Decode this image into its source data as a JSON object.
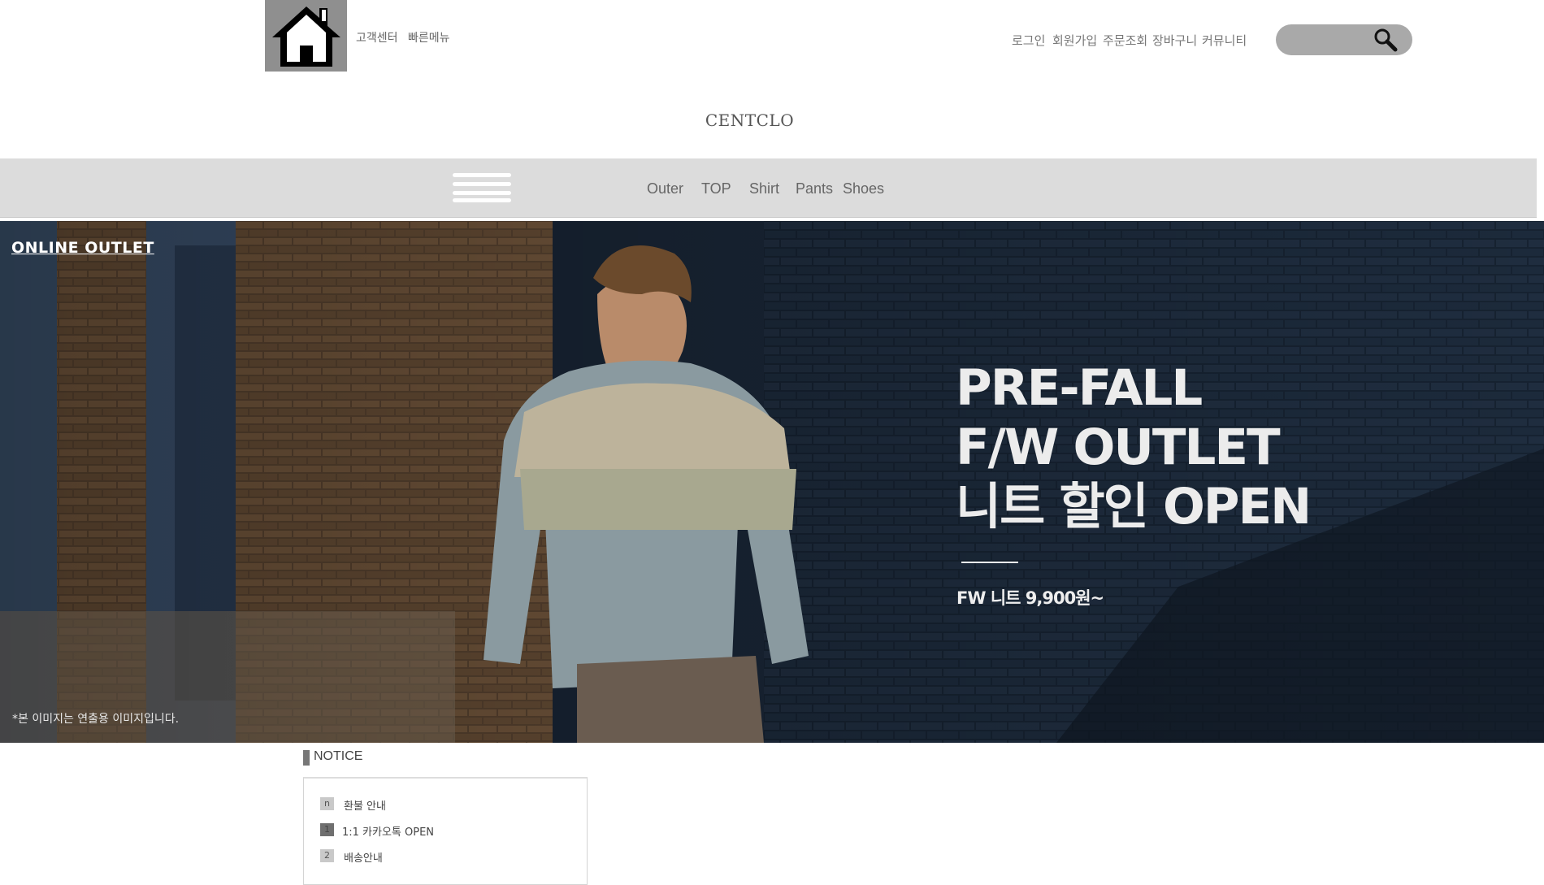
{
  "header": {
    "home_icon": "house-icon",
    "util_links": [
      "고객센터",
      "빠른메뉴"
    ],
    "top_links": [
      "로그인",
      "회원가입",
      "주문조회",
      "장바구니",
      "커뮤니티"
    ],
    "search_icon": "magnifier-icon",
    "brand": "CENTCLO"
  },
  "nav": {
    "menu_icon": "hamburger-icon",
    "items": [
      "Outer",
      "TOP",
      "Shirt",
      "Pants",
      "Shoes"
    ]
  },
  "hero": {
    "label": "ONLINE OUTLET",
    "headline": [
      "PRE-FALL",
      "F/W OUTLET",
      "니트 할인 OPEN"
    ],
    "price": "FW 니트 9,900원~",
    "disclaimer": "*본 이미지는 연출용 이미지입니다."
  },
  "notice": {
    "title": "NOTICE",
    "items": [
      {
        "badge": "n",
        "text": "환불 안내"
      },
      {
        "badge": "1",
        "text": "1:1 카카오톡 OPEN"
      },
      {
        "badge": "2",
        "text": "배송안내"
      }
    ]
  },
  "colors": {
    "nav_bg": "#dcdcdc",
    "search_bg": "#a9a9a9",
    "home_bg": "#8f8f8f",
    "hero_wall": "#1b2736"
  }
}
